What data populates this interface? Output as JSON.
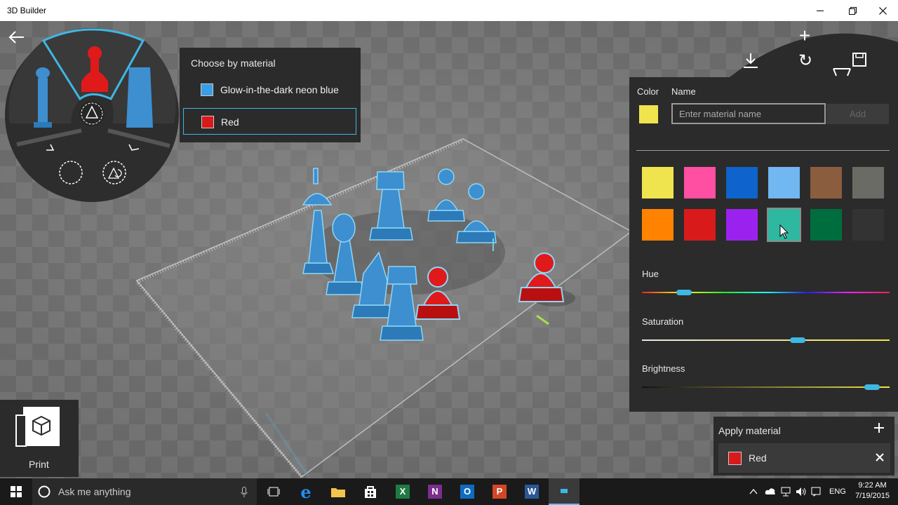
{
  "window": {
    "title": "3D Builder"
  },
  "toolbar": {
    "add": "+",
    "rotate": "↻",
    "save": "💾"
  },
  "material_panel": {
    "header": "Choose by material",
    "items": [
      {
        "label": "Glow-in-the-dark neon blue",
        "color": "#3a9de8"
      },
      {
        "label": "Red",
        "color": "#d81a1a"
      }
    ]
  },
  "color_panel": {
    "color_label": "Color",
    "name_label": "Name",
    "current_color": "#f0e44e",
    "name_placeholder": "Enter material name",
    "add_label": "Add",
    "swatches": [
      "#f0e44e",
      "#ff4fa3",
      "#0e63cc",
      "#71b7f2",
      "#8a5d3e",
      "#6b6b66",
      "#ff8200",
      "#d81a1a",
      "#9b22ee",
      "#2fb8a0",
      "#006d3f",
      "#333333"
    ],
    "selected_swatch": 9,
    "hue_label": "Hue",
    "hue_value": 0.17,
    "saturation_label": "Saturation",
    "saturation_value": 0.63,
    "brightness_label": "Brightness",
    "brightness_value": 0.93
  },
  "apply": {
    "title": "Apply material",
    "material": "Red",
    "color": "#d81a1a"
  },
  "print": {
    "label": "Print"
  },
  "taskbar": {
    "search_placeholder": "Ask me anything",
    "language": "ENG",
    "time": "9:22 AM",
    "date": "7/19/2015"
  }
}
